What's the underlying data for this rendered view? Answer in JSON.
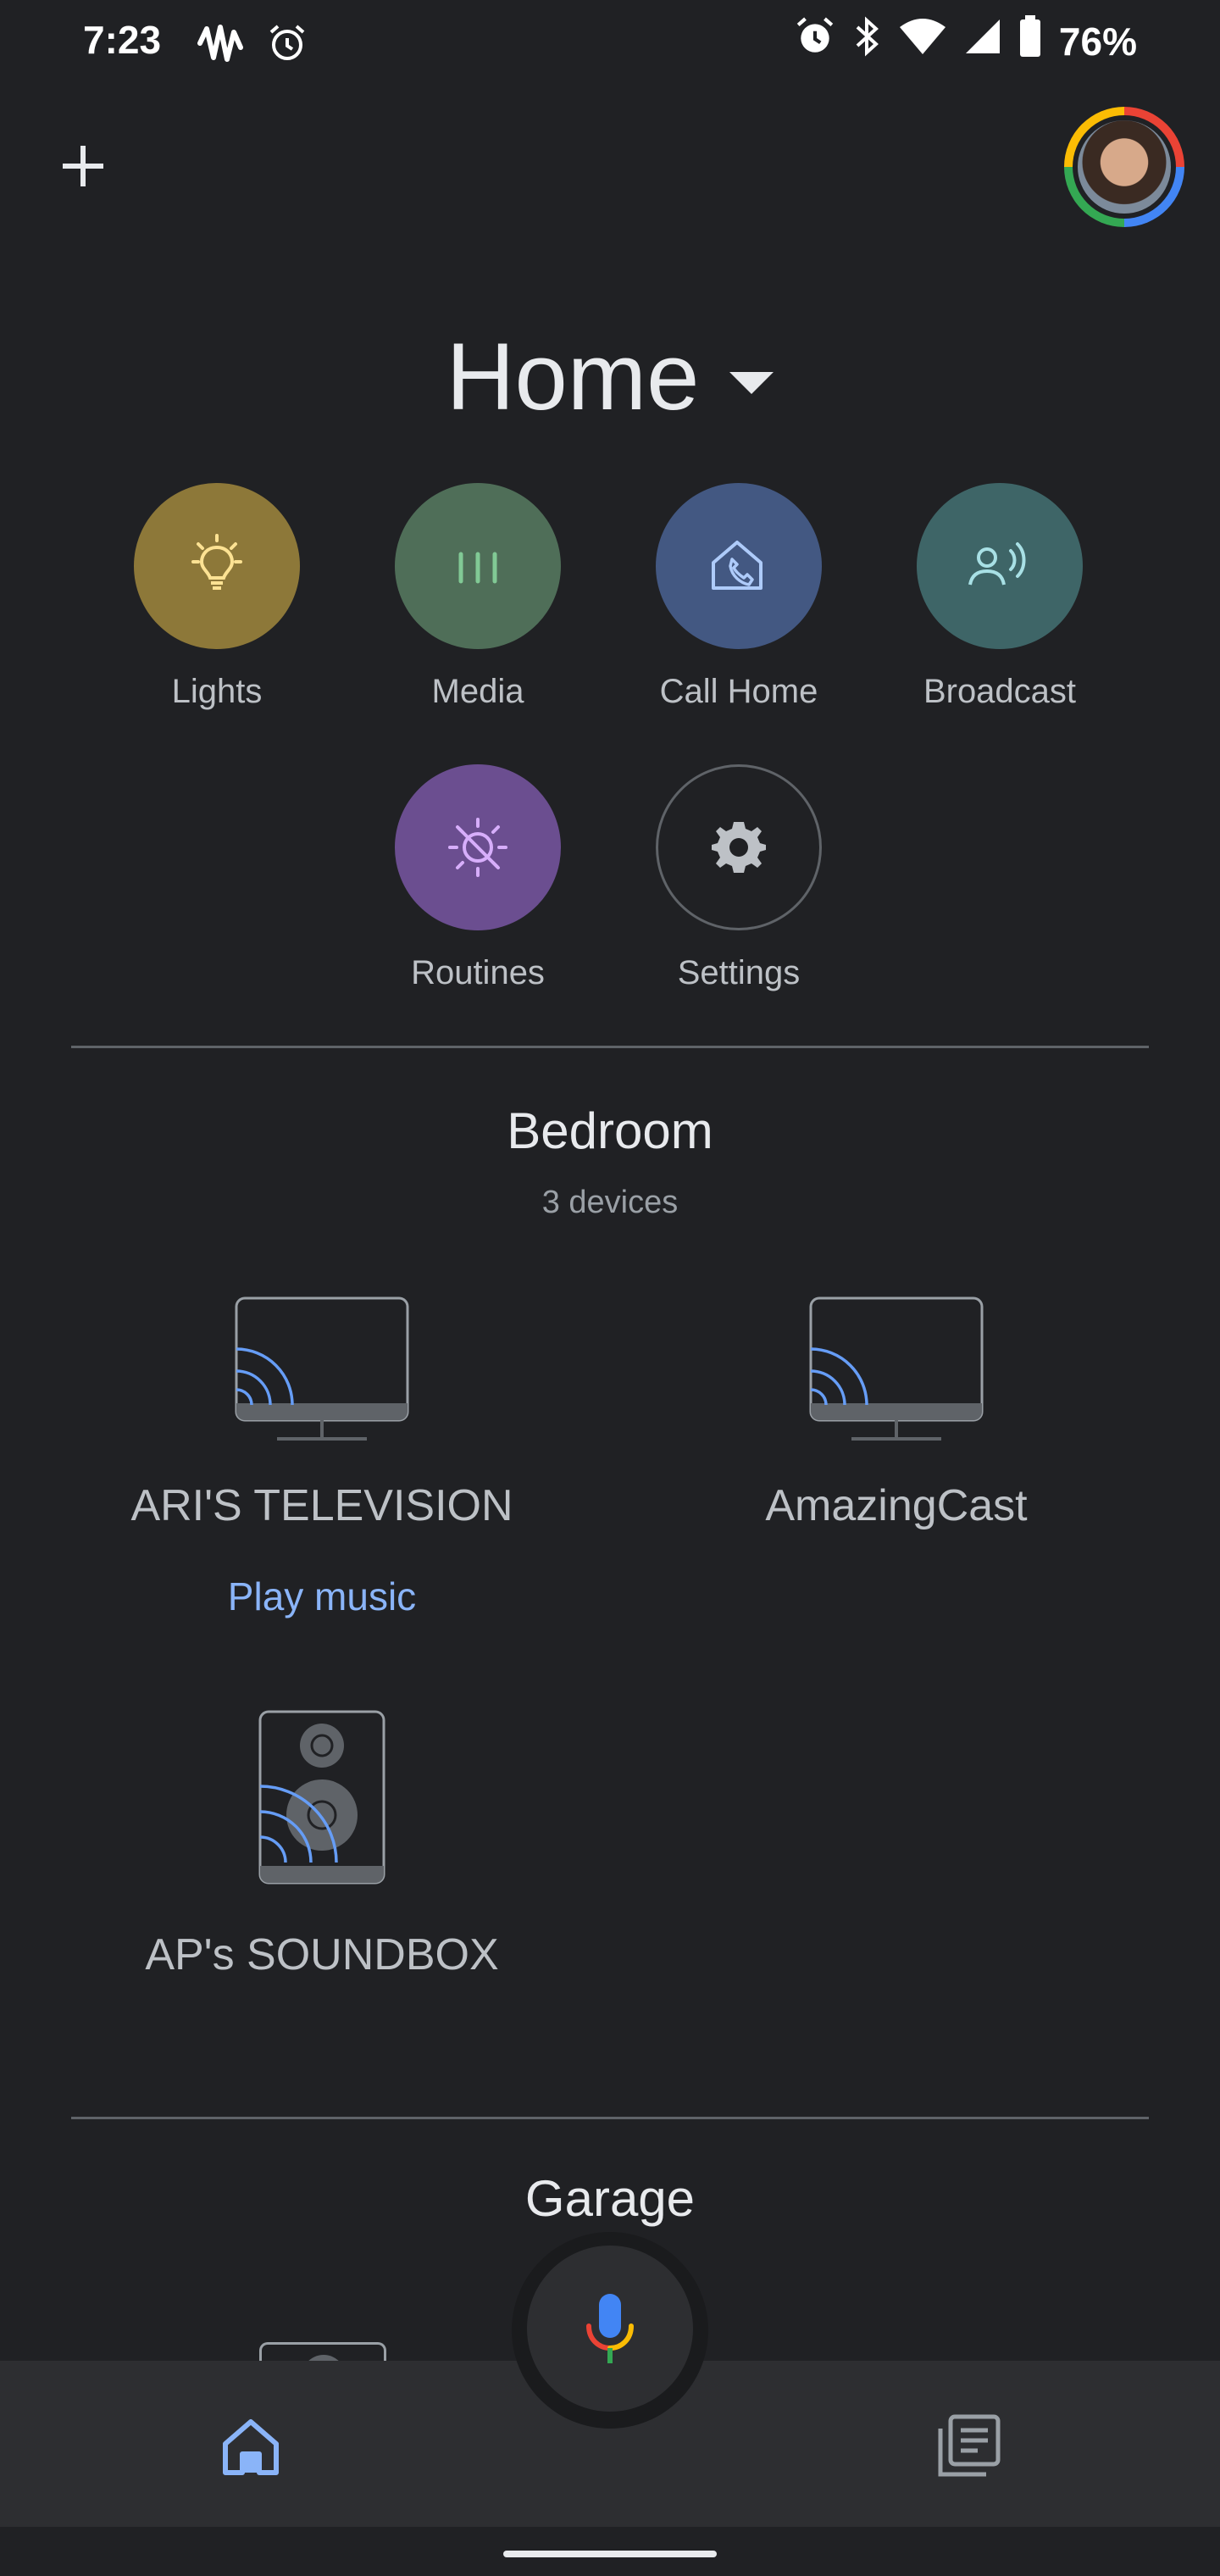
{
  "status_bar": {
    "time": "7:23",
    "battery": "76%",
    "left_icons": [
      "waveform-icon",
      "alarm-icon"
    ],
    "right_icons": [
      "alarm-icon",
      "bluetooth-icon",
      "wifi-icon",
      "signal-icon",
      "battery-icon"
    ]
  },
  "header": {
    "title": "Home",
    "add_icon": "plus-icon",
    "avatar": "account-avatar"
  },
  "shortcuts": [
    {
      "label": "Lights",
      "icon": "lightbulb-icon",
      "color": "#8d7839"
    },
    {
      "label": "Media",
      "icon": "media-bars-icon",
      "color": "#4f6e58"
    },
    {
      "label": "Call Home",
      "icon": "call-home-icon",
      "color": "#435882"
    },
    {
      "label": "Broadcast",
      "icon": "broadcast-icon",
      "color": "#3e6567"
    },
    {
      "label": "Routines",
      "icon": "routines-icon",
      "color": "#6b4e90"
    },
    {
      "label": "Settings",
      "icon": "gear-icon",
      "color": "#202124"
    }
  ],
  "rooms": [
    {
      "name": "Bedroom",
      "subtitle": "3 devices",
      "devices": [
        {
          "name": "ARI'S TELEVISION",
          "icon": "cast-tv-icon",
          "action": "Play music"
        },
        {
          "name": "AmazingCast",
          "icon": "cast-tv-icon"
        },
        {
          "name": "AP's SOUNDBOX",
          "icon": "speaker-icon"
        }
      ]
    },
    {
      "name": "Garage"
    }
  ],
  "bottom_nav": {
    "items": [
      {
        "name": "home",
        "icon": "home-icon",
        "active": true
      },
      {
        "name": "feed",
        "icon": "feed-icon",
        "active": false
      }
    ],
    "fab_icon": "microphone-icon"
  },
  "colors": {
    "background": "#202124",
    "accent": "#8ab4f8",
    "nav_bar": "#2d2e31"
  }
}
